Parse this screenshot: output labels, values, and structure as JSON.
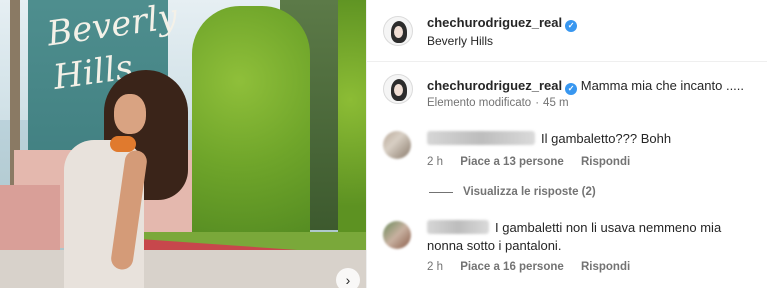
{
  "post": {
    "username": "chechurodriguez_real",
    "location": "Beverly Hills",
    "sign_text": "Beverly Hills"
  },
  "caption": {
    "username": "chechurodriguez_real",
    "text": "Mamma mia che incanto .....",
    "edited_label": "Elemento modificato",
    "time": "45 m"
  },
  "comments": [
    {
      "text": "Il gambaletto??? Bohh",
      "time": "2 h",
      "likes": "Piace a 13 persone",
      "reply": "Rispondi",
      "view_replies": "Visualizza le risposte (2)"
    },
    {
      "text": "I gambaletti non li usava nemmeno mia nonna sotto i pantaloni.",
      "time": "2 h",
      "likes": "Piace a 16 persone",
      "reply": "Rispondi"
    }
  ],
  "icons": {
    "verified": "verified-badge-icon",
    "next": "chevron-right-icon"
  },
  "colors": {
    "verified": "#3897f0",
    "secondary_text": "#737373"
  }
}
